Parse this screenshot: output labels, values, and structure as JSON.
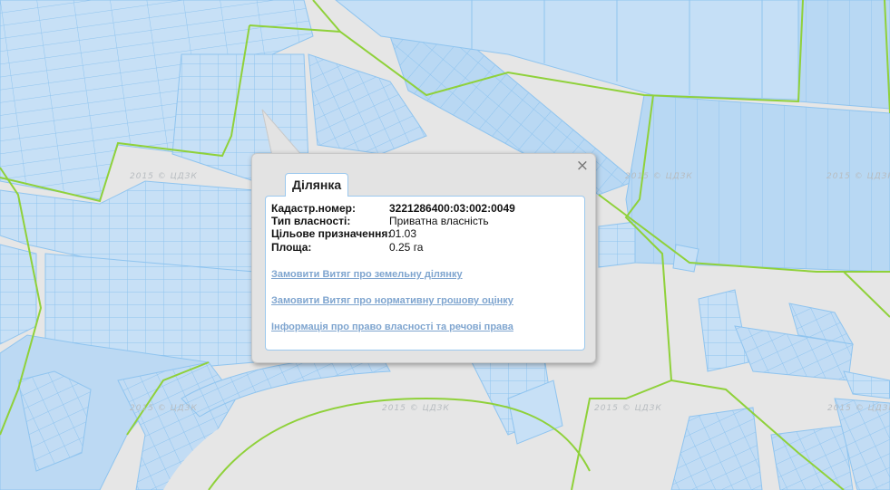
{
  "popup": {
    "tab_label": "Ділянка",
    "close_symbol": "×",
    "fields": [
      {
        "label": "Кадастр.номер:",
        "value": "3221286400:03:002:0049",
        "strong": true
      },
      {
        "label": "Тип власності:",
        "value": "Приватна власність",
        "strong": false
      },
      {
        "label": "Цільове призначення:",
        "value": "01.03",
        "strong": false
      },
      {
        "label": "Площа:",
        "value": "0.25 га",
        "strong": false
      }
    ],
    "links": [
      "Замовити Витяг про земельну ділянку",
      "Замовити Витяг про нормативну грошову оцінку",
      "Інформація про право власності та речові права"
    ]
  },
  "map": {
    "watermark": "2015 © ЦДЗК",
    "colors": {
      "background": "#e6e6e6",
      "parcel_fill": "#c7e0f6",
      "parcel_fill_dark": "#b4d6f2",
      "parcel_stroke": "#8fc4ef",
      "boundary": "#8fd13a",
      "link": "#7fa5cf"
    }
  }
}
